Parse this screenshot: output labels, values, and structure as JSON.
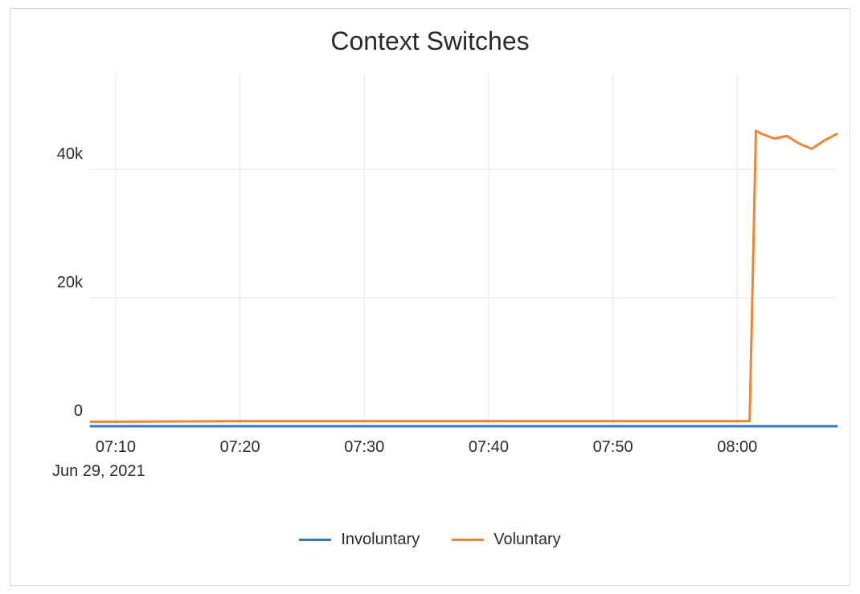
{
  "chart_data": {
    "type": "line",
    "title": "Context Switches",
    "xlabel": "",
    "ylabel": "",
    "x_date_label": "Jun 29, 2021",
    "x_ticks": [
      "07:10",
      "07:20",
      "07:30",
      "07:40",
      "07:50",
      "08:00"
    ],
    "y_ticks": [
      {
        "value": 0,
        "label": "0"
      },
      {
        "value": 20000,
        "label": "20k"
      },
      {
        "value": 40000,
        "label": "40k"
      }
    ],
    "ylim": [
      0,
      55000
    ],
    "x_range_minutes": [
      428,
      488
    ],
    "grid": {
      "x": true,
      "y": true
    },
    "legend_position": "bottom-center",
    "colors": {
      "Involuntary": "#2f79c2",
      "Voluntary": "#f08533"
    },
    "series": [
      {
        "name": "Involuntary",
        "x_minutes": [
          428,
          430,
          440,
          450,
          460,
          470,
          480,
          481,
          482,
          483,
          484,
          485,
          486,
          487,
          488
        ],
        "values": [
          0,
          0,
          0,
          0,
          0,
          0,
          0,
          0,
          0,
          0,
          0,
          0,
          0,
          0,
          0
        ]
      },
      {
        "name": "Voluntary",
        "x_minutes": [
          428,
          430,
          440,
          450,
          460,
          470,
          480,
          481,
          481.5,
          482,
          483,
          484,
          485,
          486,
          487,
          488
        ],
        "values": [
          700,
          700,
          800,
          800,
          800,
          800,
          800,
          800,
          46000,
          45500,
          44800,
          45200,
          44000,
          43200,
          44500,
          45500
        ]
      }
    ]
  },
  "legend": {
    "items": [
      {
        "key": "involuntary",
        "label": "Involuntary"
      },
      {
        "key": "voluntary",
        "label": "Voluntary"
      }
    ]
  }
}
